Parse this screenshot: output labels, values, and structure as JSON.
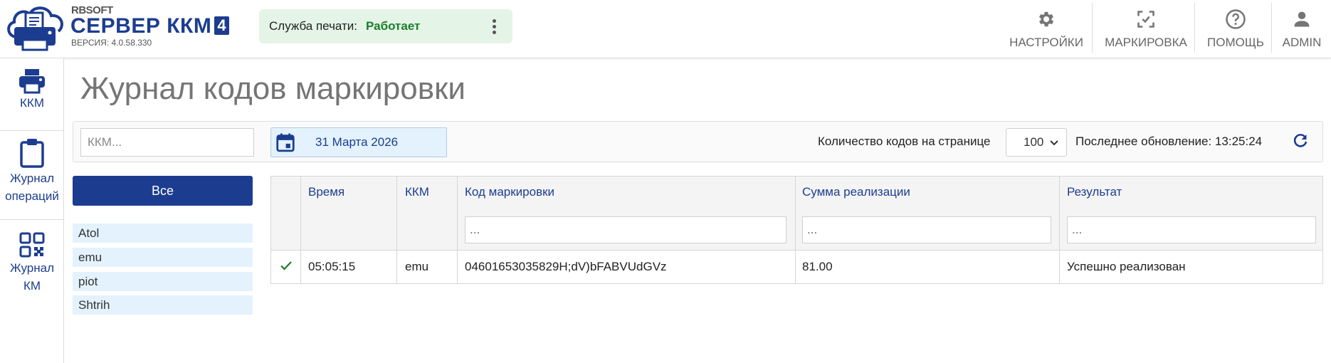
{
  "app": {
    "brand_small": "RBSOFT",
    "brand_name": "СЕРВЕР ККМ",
    "brand_version_badge": "4",
    "version_text": "ВЕРСИЯ: 4.0.58.330"
  },
  "print_service": {
    "label": "Служба печати:",
    "status": "Работает"
  },
  "top_nav": [
    {
      "label": "НАСТРОЙКИ",
      "icon": "gear-icon"
    },
    {
      "label": "МАРКИРОВКА",
      "icon": "scan-icon"
    },
    {
      "label": "ПОМОЩЬ",
      "icon": "help-icon"
    },
    {
      "label": "ADMIN",
      "icon": "user-icon"
    }
  ],
  "sidebar": {
    "items": [
      {
        "label": "ККМ",
        "icon": "printer-icon"
      },
      {
        "label": "Журнал операций",
        "icon": "clipboard-icon"
      },
      {
        "label": "Журнал КМ",
        "icon": "qr-code-icon"
      }
    ]
  },
  "page": {
    "title": "Журнал кодов маркировки"
  },
  "toolbar": {
    "kkm_placeholder": "ККМ...",
    "date": "31 Марта 2026",
    "per_page_label": "Количество кодов на странице",
    "per_page_value": "100",
    "last_update": "Последнее обновление: 13:25:24"
  },
  "kkm_filter": {
    "all_label": "Все",
    "items": [
      "Atol",
      "emu",
      "piot",
      "Shtrih"
    ]
  },
  "table": {
    "columns": [
      "Время",
      "ККМ",
      "Код маркировки",
      "Сумма реализации",
      "Результат"
    ],
    "filter_placeholder": "...",
    "rows": [
      {
        "status": "success",
        "time": "05:05:15",
        "kkm": "emu",
        "code": "04601653035829H;dV)bFABVUdGVz",
        "sum": "81.00",
        "result": "Успешно реализован"
      }
    ]
  },
  "colors": {
    "brand": "#1c3d8f",
    "status_ok": "#1a7f2a",
    "highlight_bg": "#e3f2fd",
    "service_bg": "#e4f4e6"
  }
}
